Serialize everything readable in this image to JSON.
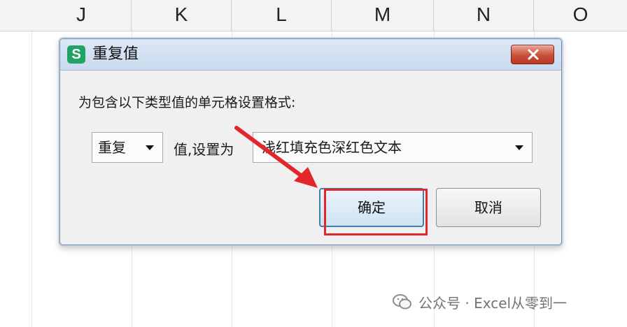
{
  "sheet": {
    "columns": [
      "J",
      "K",
      "L",
      "M",
      "N",
      "O"
    ]
  },
  "dialog": {
    "title": "重复值",
    "app_icon_letter": "S",
    "prompt": "为包含以下类型值的单元格设置格式:",
    "duplicate_select": {
      "value": "重复"
    },
    "set_as_label": "值,设置为",
    "format_select": {
      "value": "浅红填充色深红色文本"
    },
    "ok_label": "确定",
    "cancel_label": "取消"
  },
  "annotation": {
    "color": "#e3262b"
  },
  "watermark": {
    "text": "公众号 · Excel从零到一"
  },
  "colors": {
    "app_icon": "#21a366",
    "close_button": "#c8503a",
    "titlebar": "#c9dbee",
    "highlight": "#e3262b"
  }
}
